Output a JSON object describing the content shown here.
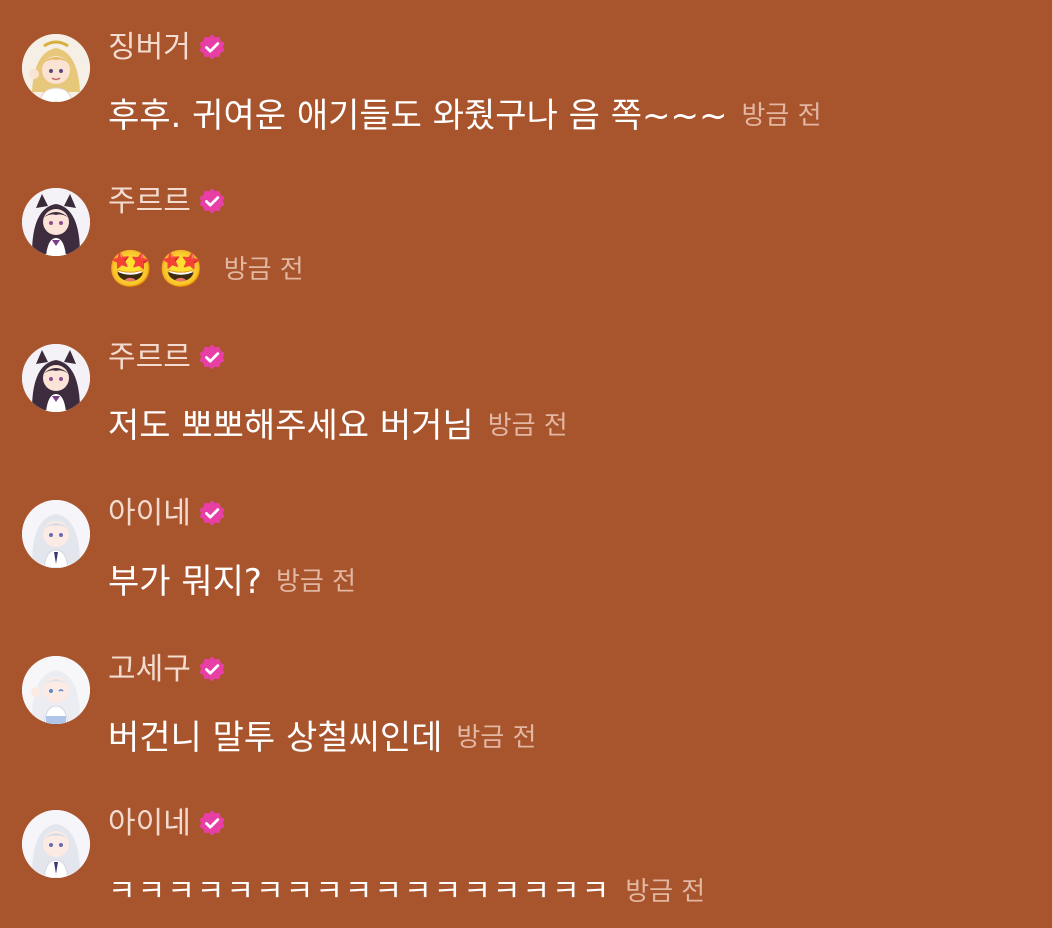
{
  "colors": {
    "background": "#A8542D",
    "name": "#F3DCCF",
    "message": "#FFFFFF",
    "timestamp": "#E2B7A2",
    "verified_badge": "#E83FA6"
  },
  "messages": [
    {
      "user": "징버거",
      "avatar": "avatar-blonde-girl",
      "verified_icon": "verified-badge-icon",
      "text": "후후. 귀여운 애기들도 와줬구나 음 쪽~~~",
      "time": "방금 전"
    },
    {
      "user": "주르르",
      "avatar": "avatar-dark-hair-cat-ears",
      "verified_icon": "verified-badge-icon",
      "text": "🤩🤩",
      "time": "방금 전"
    },
    {
      "user": "주르르",
      "avatar": "avatar-dark-hair-cat-ears",
      "verified_icon": "verified-badge-icon",
      "text": "저도 뽀뽀해주세요 버거님",
      "time": "방금 전"
    },
    {
      "user": "아이네",
      "avatar": "avatar-silver-hair",
      "verified_icon": "verified-badge-icon",
      "text": "부가 뭐지?",
      "time": "방금 전"
    },
    {
      "user": "고세구",
      "avatar": "avatar-white-hair",
      "verified_icon": "verified-badge-icon",
      "text": "버건니 말투 상철씨인데",
      "time": "방금 전"
    },
    {
      "user": "아이네",
      "avatar": "avatar-silver-hair",
      "verified_icon": "verified-badge-icon",
      "text": "ㅋㅋㅋㅋㅋㅋㅋㅋㅋㅋㅋㅋㅋㅋㅋㅋㅋ",
      "time": "방금 전"
    }
  ]
}
